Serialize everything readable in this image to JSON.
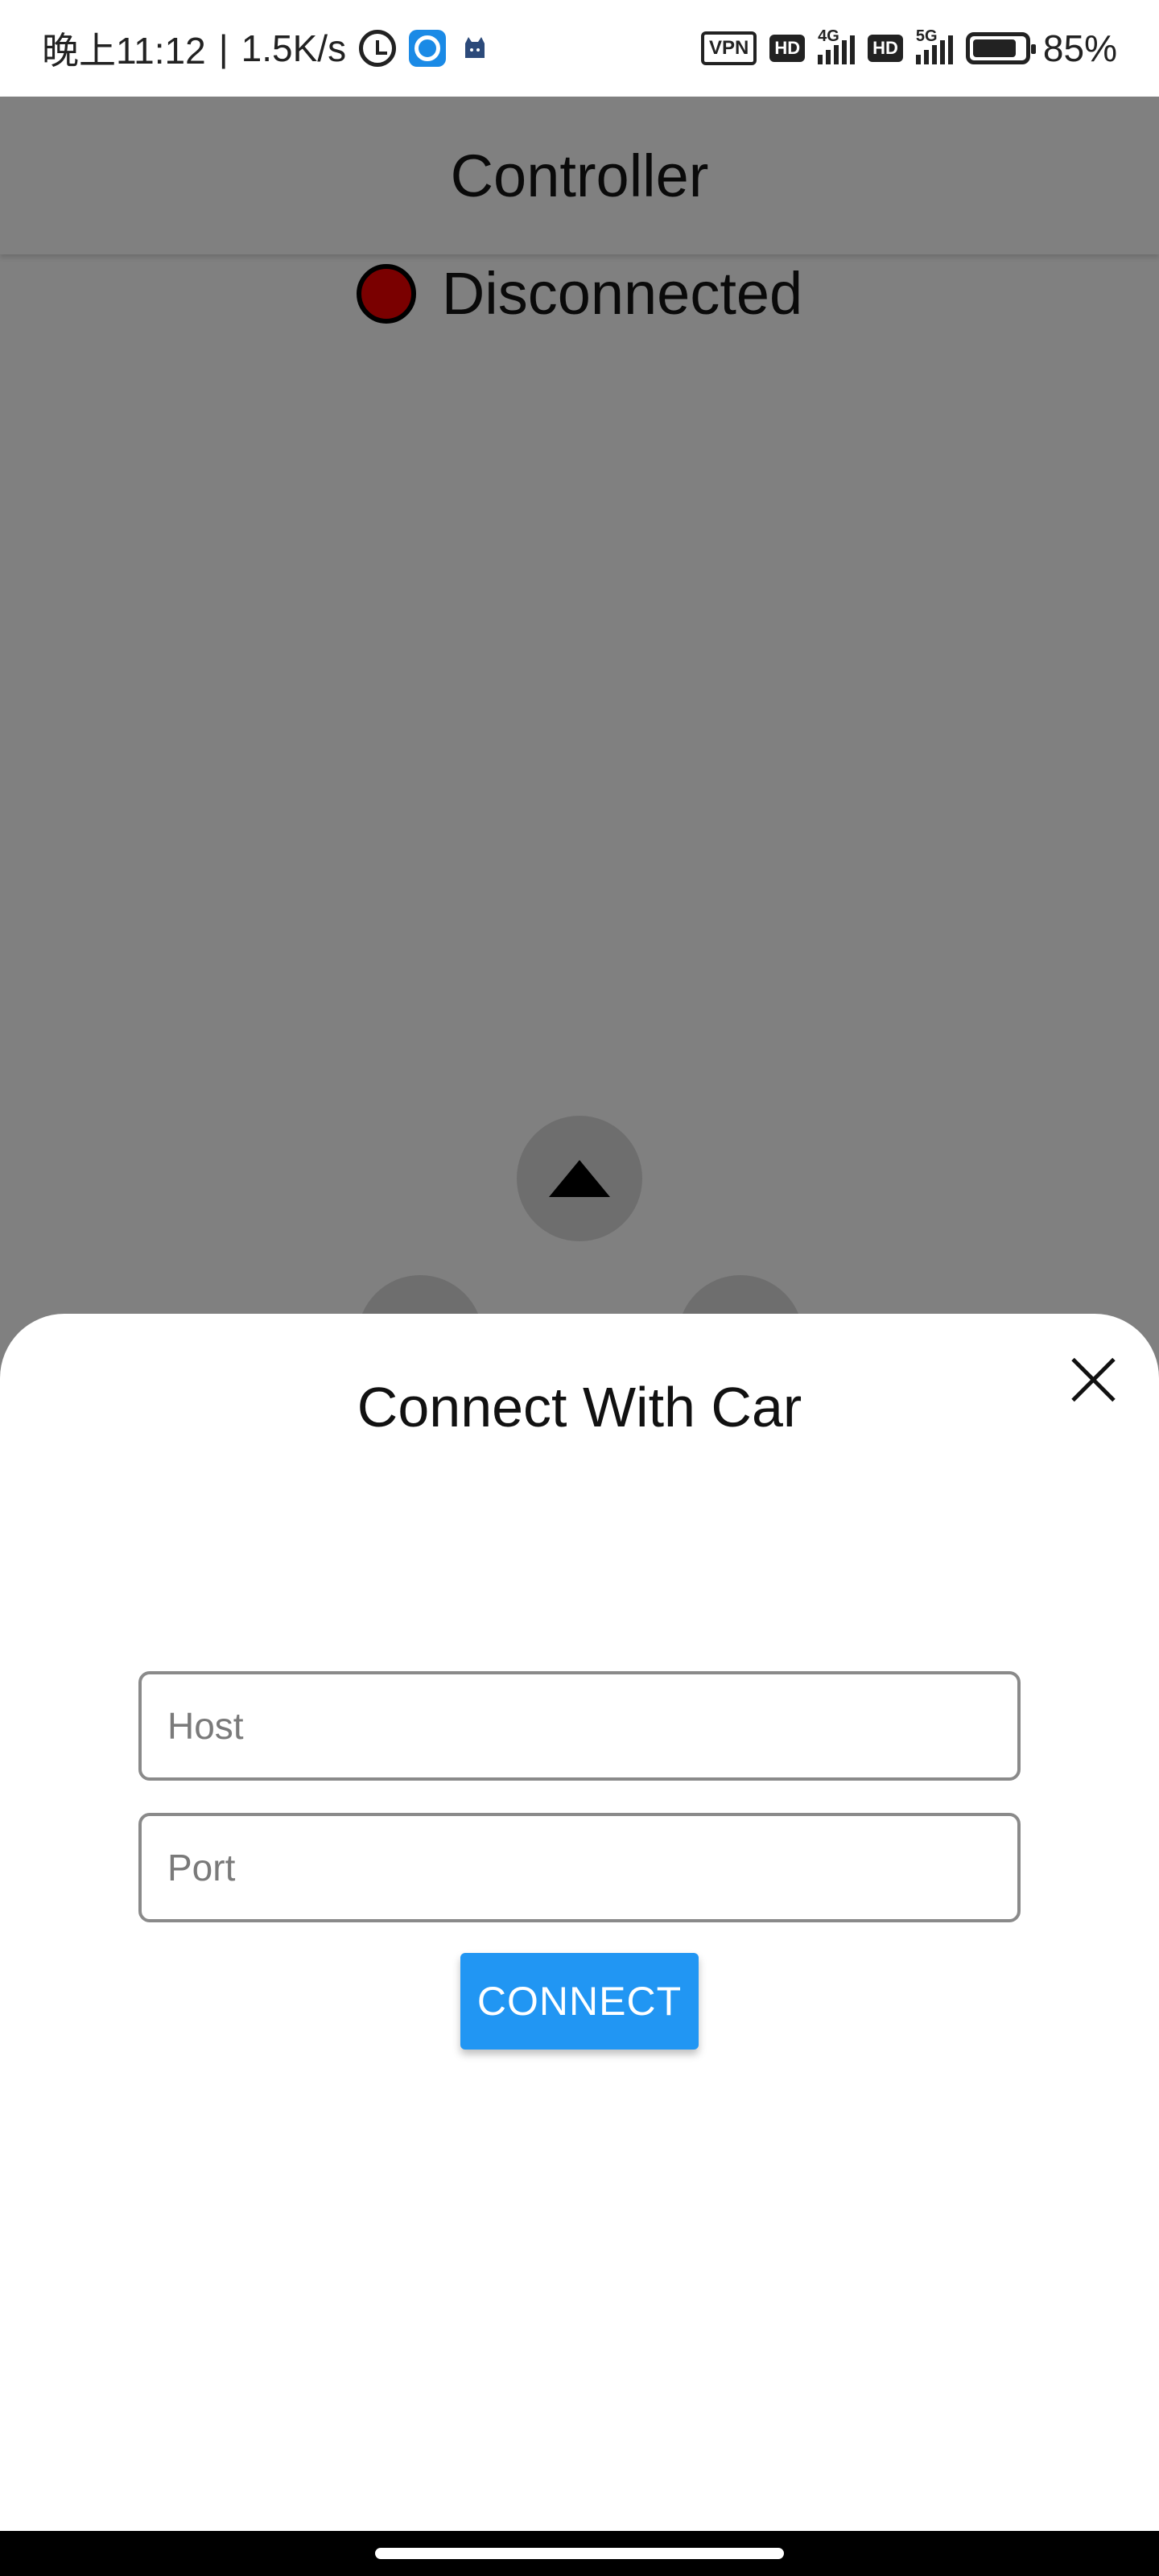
{
  "status_bar": {
    "time": "晚上11:12",
    "separator": "|",
    "net_speed": "1.5K/s",
    "vpn": "VPN",
    "hd1": "HD",
    "net1": "4G",
    "hd2": "HD",
    "net2": "5G",
    "battery_level": 0.85,
    "battery": "85%"
  },
  "app_bar": {
    "title": "Controller"
  },
  "connection": {
    "status": "Disconnected",
    "indicator_color": "#7a0000"
  },
  "dialog": {
    "title": "Connect With Car",
    "host_placeholder": "Host",
    "port_placeholder": "Port",
    "connect_label": "CONNECT",
    "accent_color": "#2196f3"
  },
  "icons": {
    "close": "close-icon",
    "up": "arrow-up-icon",
    "left": "arrow-left-icon",
    "right": "arrow-right-icon"
  }
}
